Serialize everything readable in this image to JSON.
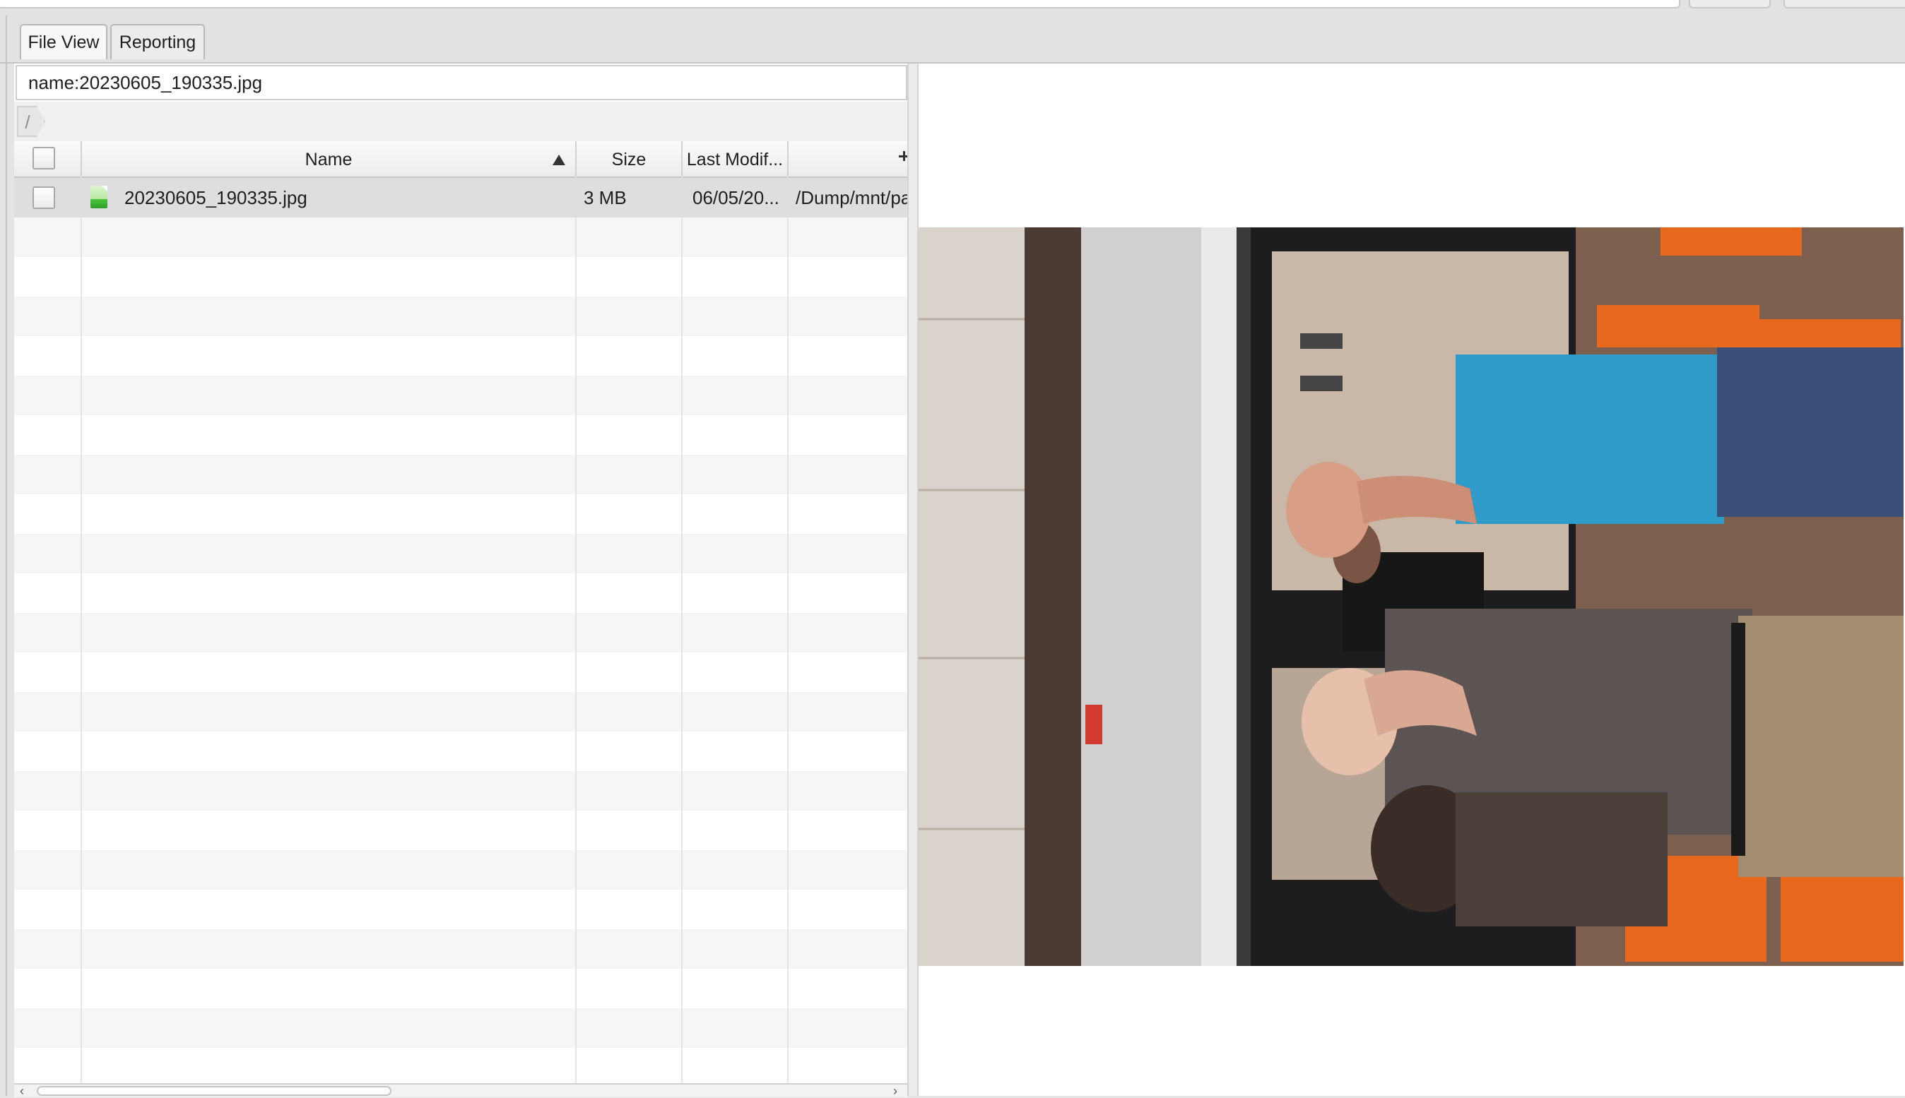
{
  "tabs": [
    {
      "label": "File View",
      "active": true
    },
    {
      "label": "Reporting",
      "active": false
    }
  ],
  "search": {
    "value": "name:20230605_190335.jpg"
  },
  "breadcrumb": {
    "root": "/"
  },
  "table": {
    "columns": [
      "",
      "Name",
      "Size",
      "Last Modif...",
      ""
    ],
    "sort": {
      "column": "Name",
      "direction": "ascending"
    },
    "rows": [
      {
        "name": "20230605_190335.jpg",
        "size": "3 MB",
        "modified": "06/05/20...",
        "path": "/Dump/mnt/pa",
        "icon": "image-file-icon",
        "selected": true
      }
    ]
  },
  "preview": {
    "image": "rotated photo: two men in blue and grey shirts shading their eyes, standing near a glass storefront with orange chairs",
    "colors": {
      "wall": "#d6d0c8",
      "shirt_blue": "#2e9bc8",
      "shirt_grey": "#5e5654",
      "pants_khaki": "#a48e72",
      "chairs": "#e8691e",
      "floor": "#8a6a58"
    }
  }
}
